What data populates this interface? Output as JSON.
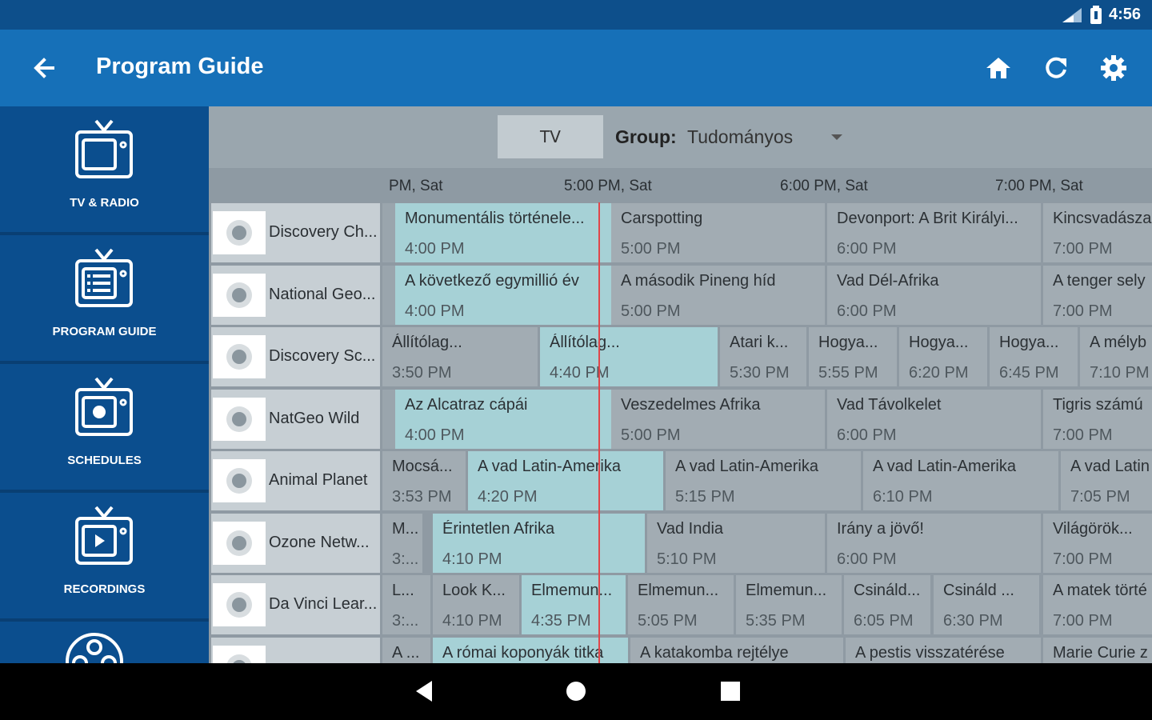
{
  "status": {
    "time": "4:56"
  },
  "appbar": {
    "title": "Program Guide"
  },
  "sidebar": {
    "items": [
      {
        "label": "TV & RADIO",
        "icon": "tv-icon"
      },
      {
        "label": "PROGRAM GUIDE",
        "icon": "tv-guide-icon"
      },
      {
        "label": "SCHEDULES",
        "icon": "tv-record-icon"
      },
      {
        "label": "RECORDINGS",
        "icon": "tv-play-icon"
      },
      {
        "label": "",
        "icon": "reel-icon"
      }
    ]
  },
  "filter": {
    "tv_label": "TV",
    "group_label": "Group:",
    "group_value": "Tudományos"
  },
  "timeline": {
    "labels": [
      "PM, Sat",
      "5:00 PM, Sat",
      "6:00 PM, Sat",
      "7:00 PM, Sat"
    ]
  },
  "channels": [
    {
      "name": "Discovery Ch...",
      "programs": [
        {
          "title": "Monumentális történele...",
          "time": "4:00 PM",
          "now": true
        },
        {
          "title": "Carspotting",
          "time": "5:00 PM"
        },
        {
          "title": "Devonport: A Brit Királyi...",
          "time": "6:00 PM"
        },
        {
          "title": "Kincsvadásza",
          "time": "7:00 PM"
        }
      ]
    },
    {
      "name": "National Geo...",
      "programs": [
        {
          "title": "A következő egymillió év",
          "time": "4:00 PM",
          "now": true
        },
        {
          "title": "A második Pineng híd",
          "time": "5:00 PM"
        },
        {
          "title": "Vad Dél-Afrika",
          "time": "6:00 PM"
        },
        {
          "title": "A tenger sely",
          "time": "7:00 PM"
        }
      ]
    },
    {
      "name": "Discovery Sc...",
      "programs": [
        {
          "title": "Állítólag...",
          "time": "3:50 PM"
        },
        {
          "title": "Állítólag...",
          "time": "4:40 PM",
          "now": true
        },
        {
          "title": "Atari k...",
          "time": "5:30 PM"
        },
        {
          "title": "Hogya...",
          "time": "5:55 PM"
        },
        {
          "title": "Hogya...",
          "time": "6:20 PM"
        },
        {
          "title": "Hogya...",
          "time": "6:45 PM"
        },
        {
          "title": "A mélyb",
          "time": "7:10 PM"
        }
      ]
    },
    {
      "name": "NatGeo Wild",
      "programs": [
        {
          "title": "Az Alcatraz cápái",
          "time": "4:00 PM",
          "now": true
        },
        {
          "title": "Veszedelmes Afrika",
          "time": "5:00 PM"
        },
        {
          "title": "Vad Távolkelet",
          "time": "6:00 PM"
        },
        {
          "title": "Tigris számú",
          "time": "7:00 PM"
        }
      ]
    },
    {
      "name": "Animal Planet",
      "programs": [
        {
          "title": "Mocsá...",
          "time": "3:53 PM"
        },
        {
          "title": "A vad Latin-Amerika",
          "time": "4:20 PM",
          "now": true
        },
        {
          "title": "A vad Latin-Amerika",
          "time": "5:15 PM"
        },
        {
          "title": "A vad Latin-Amerika",
          "time": "6:10 PM"
        },
        {
          "title": "A vad Latin",
          "time": "7:05 PM"
        }
      ]
    },
    {
      "name": "Ozone Netw...",
      "programs": [
        {
          "title": "M...",
          "time": "3:..."
        },
        {
          "title": "Érintetlen Afrika",
          "time": "4:10 PM",
          "now": true
        },
        {
          "title": "Vad India",
          "time": "5:10 PM"
        },
        {
          "title": "Irány a jövő!",
          "time": "6:00 PM"
        },
        {
          "title": "Világörök...",
          "time": "7:00 PM"
        }
      ]
    },
    {
      "name": "Da Vinci Lear...",
      "programs": [
        {
          "title": "L...",
          "time": "3:..."
        },
        {
          "title": "Look K...",
          "time": "4:10 PM"
        },
        {
          "title": "Elmemun...",
          "time": "4:35 PM",
          "now": true
        },
        {
          "title": "Elmemun...",
          "time": "5:05 PM"
        },
        {
          "title": "Elmemun...",
          "time": "5:35 PM"
        },
        {
          "title": "Csináld...",
          "time": "6:05 PM"
        },
        {
          "title": "Csináld ...",
          "time": "6:30 PM"
        },
        {
          "title": "A matek törté",
          "time": "7:00 PM"
        }
      ]
    },
    {
      "name": "",
      "programs": [
        {
          "title": "A ...",
          "time": ""
        },
        {
          "title": "A római koponyák titka",
          "time": "",
          "now": true
        },
        {
          "title": "A katakomba rejtélye",
          "time": ""
        },
        {
          "title": "A pestis visszatérése",
          "time": ""
        },
        {
          "title": "Marie Curie z",
          "time": ""
        }
      ]
    }
  ]
}
